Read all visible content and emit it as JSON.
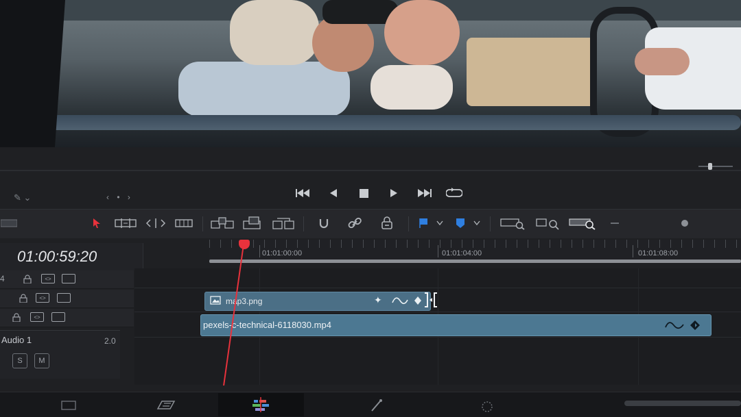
{
  "viewer": {
    "content": "video-frame"
  },
  "viewer_nav": {
    "dots": "‹ • ›"
  },
  "transport": {
    "buttons": [
      "jump-to-start",
      "play-reverse",
      "stop",
      "play",
      "jump-to-end",
      "loop"
    ]
  },
  "toolbar": {
    "tools": [
      "selection",
      "trim-edit",
      "dynamic-trim",
      "blade",
      "insert",
      "overwrite",
      "replace",
      "snapping",
      "linked-selection",
      "position-lock",
      "flag",
      "marker",
      "zoom-full",
      "zoom-detail",
      "zoom-custom"
    ],
    "flag_color": "#2f7fe0",
    "marker_color": "#2f7fe0"
  },
  "timeline": {
    "timecode": "01:00:59:20",
    "ruler_labels": [
      "01:01:00:00",
      "01:01:04:00",
      "01:01:08:00"
    ],
    "video_tracks": [
      {
        "number": "4"
      },
      {
        "number": ""
      },
      {
        "number": ""
      }
    ],
    "clips": [
      {
        "name": "map3.png",
        "track": 2
      },
      {
        "name": "pexels-c-technical-6118030.mp4",
        "track": 1
      }
    ],
    "audio_track": {
      "name": "Audio 1",
      "volume": "2.0",
      "solo": "S",
      "mute": "M"
    },
    "playhead_color": "#e8323c",
    "clip_color": "#4c7892"
  },
  "pages": [
    "media",
    "cut",
    "edit",
    "fusion",
    "color"
  ],
  "active_page": "edit"
}
